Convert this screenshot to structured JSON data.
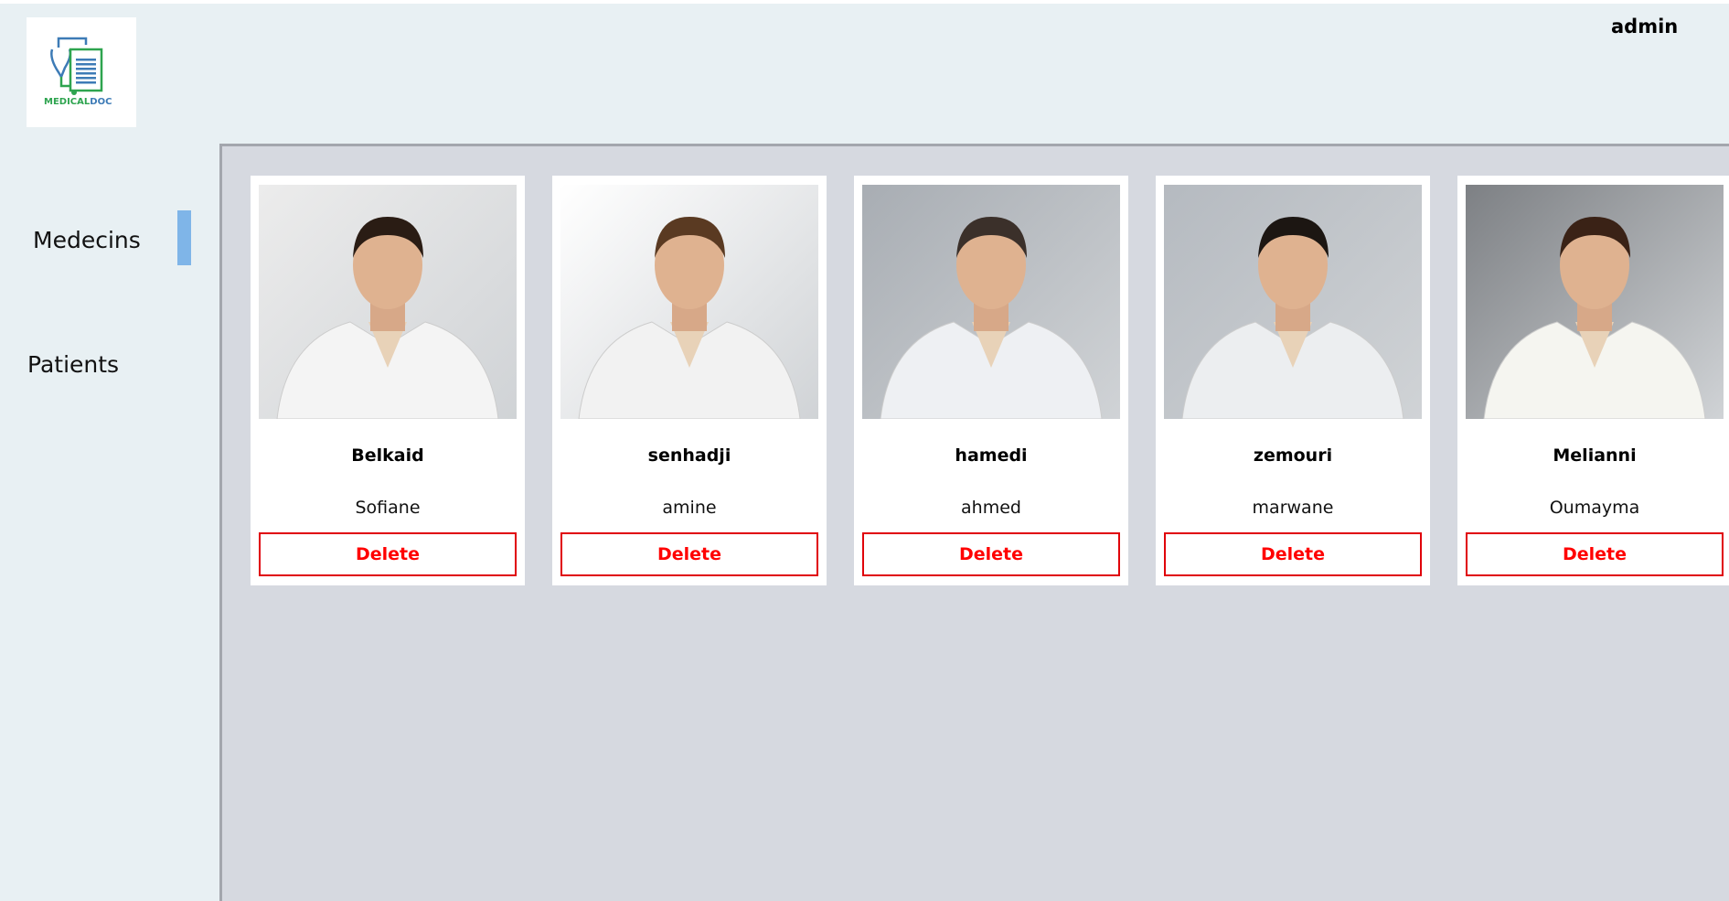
{
  "header": {
    "user": "admin",
    "logo_text": "MEDICALDOC"
  },
  "sidebar": {
    "items": [
      {
        "label": "Medecins",
        "active": true
      },
      {
        "label": "Patients",
        "active": false
      }
    ]
  },
  "doctors": [
    {
      "last": "Belkaid",
      "first": "Sofiane",
      "bg": "#ececec",
      "coat": "#f4f4f4",
      "hair": "#2a1c14"
    },
    {
      "last": "senhadji",
      "first": "amine",
      "bg": "#ffffff",
      "coat": "#f2f2f2",
      "hair": "#5a3a22"
    },
    {
      "last": "hamedi",
      "first": "ahmed",
      "bg": "#a8adb3",
      "coat": "#eef0f3",
      "hair": "#3b302a"
    },
    {
      "last": "zemouri",
      "first": "marwane",
      "bg": "#b5bac0",
      "coat": "#eceef0",
      "hair": "#1c1612"
    },
    {
      "last": "Melianni",
      "first": "Oumayma",
      "bg": "#7d8084",
      "coat": "#f5f5f0",
      "hair": "#3a2216"
    }
  ],
  "delete_label": "Delete"
}
